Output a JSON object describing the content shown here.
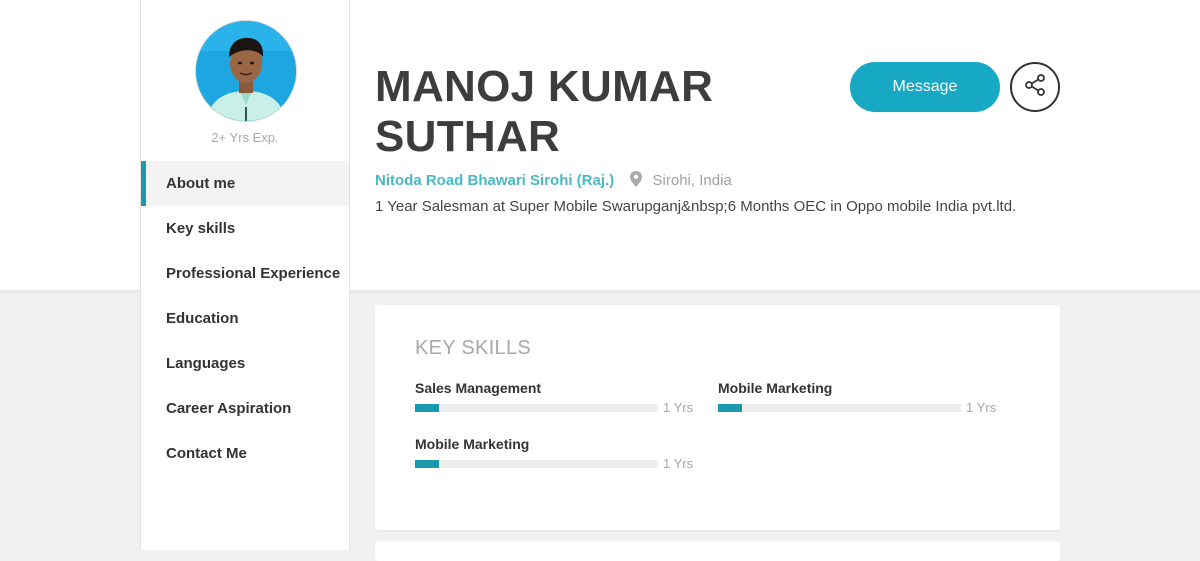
{
  "profile": {
    "experience": "2+ Yrs Exp.",
    "name": "MANOJ KUMAR SUTHAR",
    "address": "Nitoda Road Bhawari Sirohi (Raj.)",
    "location": "Sirohi, India",
    "summary": "1 Year Salesman at Super Mobile Swarupganj&nbsp;6 Months OEC in Oppo mobile India pvt.ltd."
  },
  "actions": {
    "message_label": "Message",
    "share_icon": "share-icon"
  },
  "sidebar": {
    "items": [
      {
        "label": "About me",
        "active": true
      },
      {
        "label": "Key skills",
        "active": false
      },
      {
        "label": "Professional Experience",
        "active": false
      },
      {
        "label": "Education",
        "active": false
      },
      {
        "label": "Languages",
        "active": false
      },
      {
        "label": "Career Aspiration",
        "active": false
      },
      {
        "label": "Contact Me",
        "active": false
      }
    ]
  },
  "skills": {
    "title": "KEY SKILLS",
    "items": [
      {
        "name": "Sales Management",
        "years": "1 Yrs",
        "level": 0.1
      },
      {
        "name": "Mobile Marketing",
        "years": "1 Yrs",
        "level": 0.1
      },
      {
        "name": "Mobile Marketing",
        "years": "1 Yrs",
        "level": 0.1
      }
    ]
  },
  "colors": {
    "accent": "#1a9aac",
    "button": "#17a8c4",
    "address": "#4bb8c5"
  }
}
